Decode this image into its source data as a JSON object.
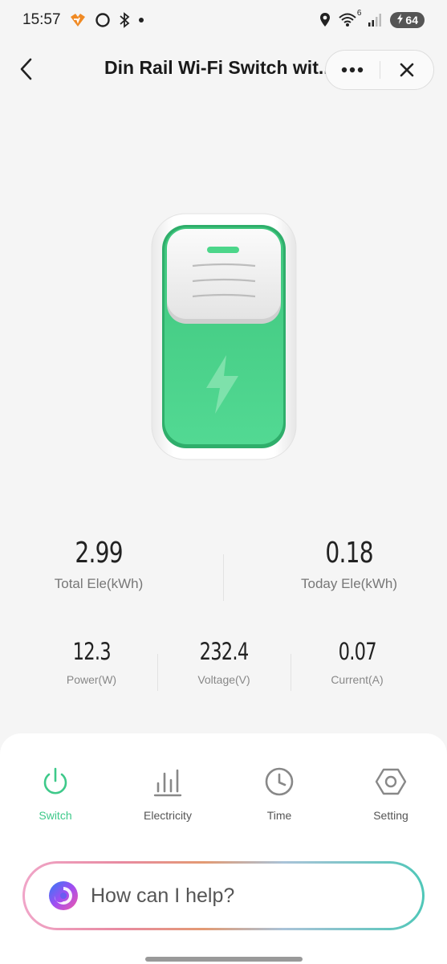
{
  "status_bar": {
    "time": "15:57",
    "battery": "64",
    "wifi_badge": "6"
  },
  "header": {
    "title": "Din Rail Wi-Fi Switch wit...",
    "more_icon": "more-dots-icon",
    "close_icon": "close-icon",
    "back_icon": "chevron-left-icon"
  },
  "stats": {
    "total_ele": {
      "value": "2.99",
      "label": "Total Ele(kWh)"
    },
    "today_ele": {
      "value": "0.18",
      "label": "Today Ele(kWh)"
    },
    "power": {
      "value": "12.3",
      "label": "Power(W)"
    },
    "voltage": {
      "value": "232.4",
      "label": "Voltage(V)"
    },
    "current": {
      "value": "0.07",
      "label": "Current(A)"
    }
  },
  "tabs": [
    {
      "label": "Switch",
      "icon": "power-icon",
      "active": true
    },
    {
      "label": "Electricity",
      "icon": "bar-chart-icon",
      "active": false
    },
    {
      "label": "Time",
      "icon": "clock-icon",
      "active": false
    },
    {
      "label": "Setting",
      "icon": "hex-nut-icon",
      "active": false
    }
  ],
  "assistant": {
    "placeholder": "How can I help?"
  },
  "colors": {
    "accent": "#3ec98a",
    "device_green": "#4cd68a",
    "background": "#f5f5f5"
  }
}
